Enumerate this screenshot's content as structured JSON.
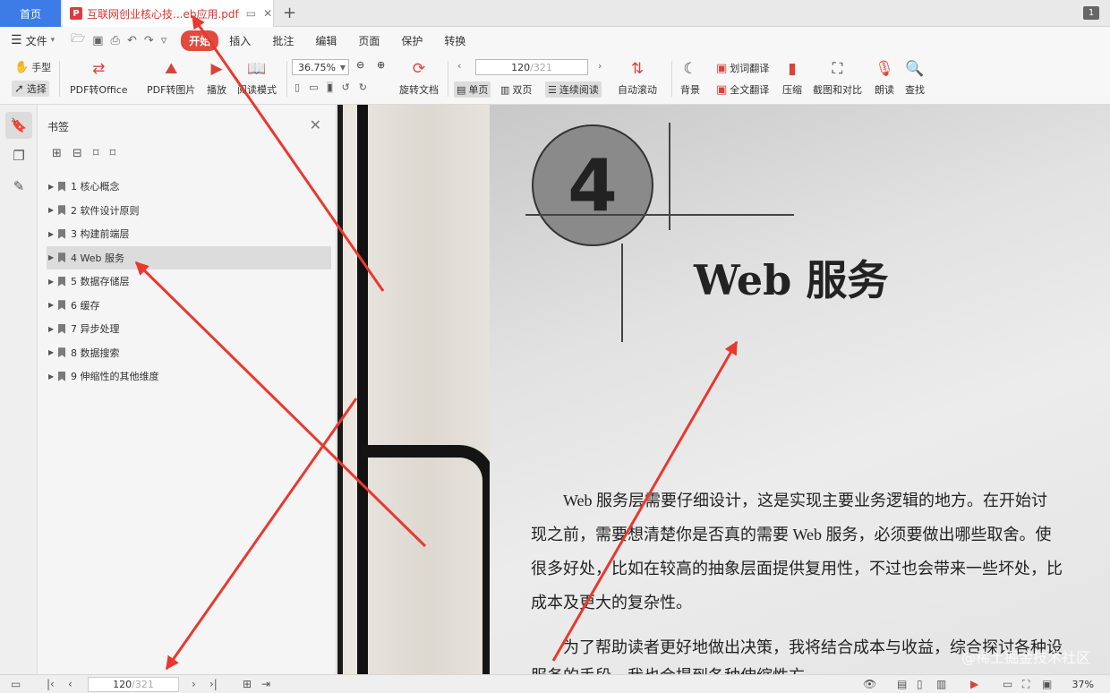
{
  "tabs": {
    "home_label": "首页",
    "doc_title": "互联网创业核心技...eb应用.pdf",
    "pdf_badge": "P",
    "window_count": "1"
  },
  "menu": {
    "file_label": "文件",
    "tabs": [
      "开始",
      "插入",
      "批注",
      "编辑",
      "页面",
      "保护",
      "转换"
    ]
  },
  "ribbon": {
    "hand_label": "手型",
    "select_label": "选择",
    "pdf_to_office": "PDF转Office",
    "pdf_to_image": "PDF转图片",
    "play": "播放",
    "read_mode": "阅读模式",
    "zoom_value": "36.75%",
    "rotate_doc": "旋转文档",
    "page_current": "120",
    "page_total": "/321",
    "single_page": "单页",
    "double_page": "双页",
    "continuous": "连续阅读",
    "auto_scroll": "自动滚动",
    "background": "背景",
    "word_translate": "划词翻译",
    "full_translate": "全文翻译",
    "compress": "压缩",
    "screenshot_compare": "截图和对比",
    "read_aloud": "朗读",
    "find": "查找"
  },
  "bookmarks": {
    "title": "书签",
    "items": [
      {
        "label": "1 核心概念"
      },
      {
        "label": "2 软件设计原则"
      },
      {
        "label": "3 构建前端层"
      },
      {
        "label": "4 Web 服务"
      },
      {
        "label": "5 数据存储层"
      },
      {
        "label": "6 缓存"
      },
      {
        "label": "7 异步处理"
      },
      {
        "label": "8 数据搜索"
      },
      {
        "label": "9 伸缩性的其他维度"
      }
    ],
    "selected_index": 3
  },
  "page": {
    "chapter_number": "4",
    "chapter_title": "Web 服务",
    "lines": [
      "Web 服务层需要仔细设计，这是实现主要业务逻辑的地方。在开始讨",
      "现之前，需要想清楚你是否真的需要 Web 服务，必须要做出哪些取舍。使",
      "很多好处，比如在较高的抽象层面提供复用性，不过也会带来一些坏处，比",
      "成本及更大的复杂性。",
      "为了帮助读者更好地做出决策，我将结合成本与收益，综合探讨各种设",
      "服务的手段。我也会提到各种伸缩性方"
    ],
    "watermark": "@稀土掘金技术社区"
  },
  "status": {
    "page_current": "120",
    "page_total": "/321",
    "zoom": "37%"
  },
  "colors": {
    "accent_blue": "#3d7be6",
    "accent_red": "#e34a3f",
    "arrow_red": "#e8392f"
  }
}
